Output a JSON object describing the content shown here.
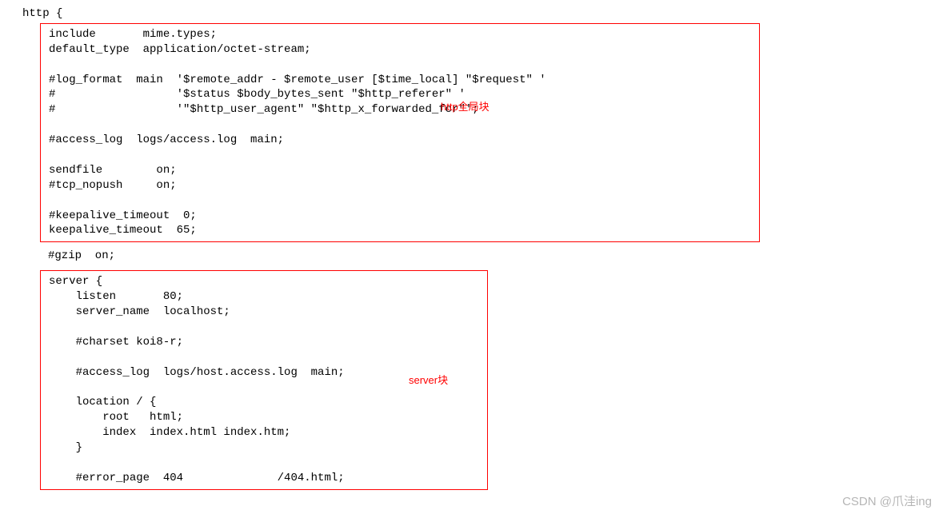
{
  "header_line": "http {",
  "block1": "include       mime.types;\ndefault_type  application/octet-stream;\n\n#log_format  main  '$remote_addr - $remote_user [$time_local] \"$request\" '\n#                  '$status $body_bytes_sent \"$http_referer\" '\n#                  '\"$http_user_agent\" \"$http_x_forwarded_for\"';\n\n#access_log  logs/access.log  main;\n\nsendfile        on;\n#tcp_nopush     on;\n\n#keepalive_timeout  0;\nkeepalive_timeout  65;",
  "gzip_line": "#gzip  on;",
  "block2": "server {\n    listen       80;\n    server_name  localhost;\n\n    #charset koi8-r;\n\n    #access_log  logs/host.access.log  main;\n\n    location / {\n        root   html;\n        index  index.html index.htm;\n    }\n\n    #error_page  404              /404.html;",
  "annotation1": "http全局块",
  "annotation2": "server块",
  "watermark": "CSDN @爪洼ing"
}
